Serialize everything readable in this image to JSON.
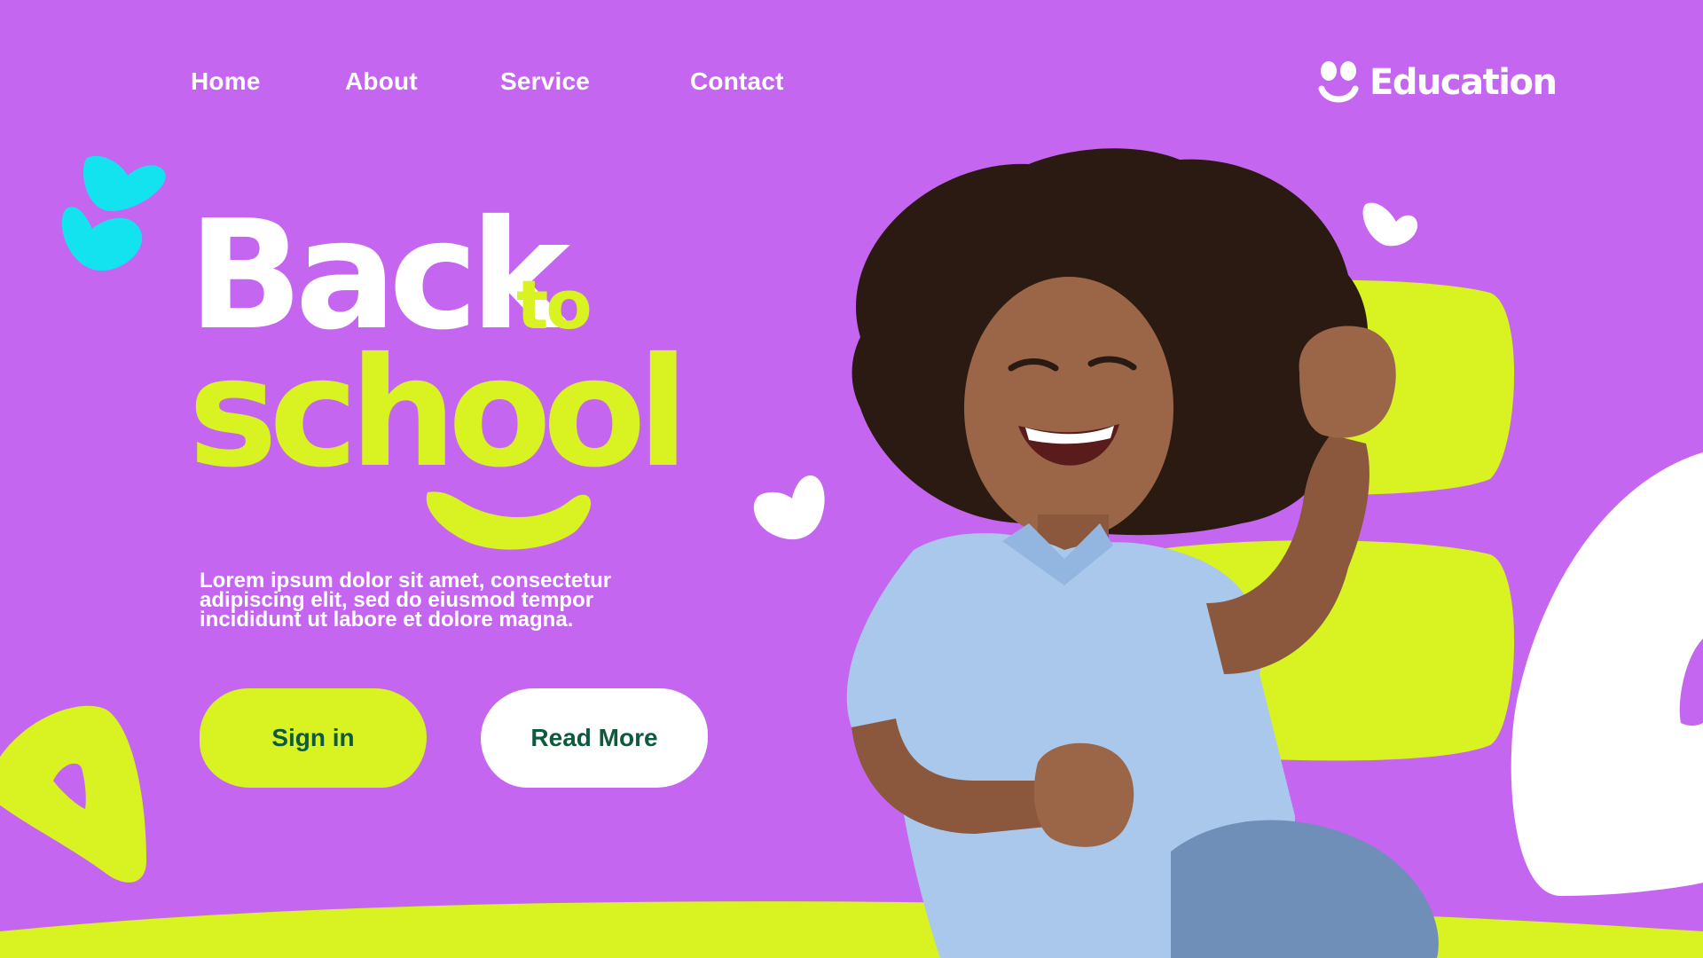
{
  "nav": {
    "links": [
      {
        "label": "Home"
      },
      {
        "label": "About"
      },
      {
        "label": "Service"
      },
      {
        "label": "Contact"
      }
    ]
  },
  "brand": {
    "name": "Education",
    "icon": "smiley-face-icon"
  },
  "hero": {
    "line1": "Back",
    "line1b": "to",
    "line2": "school",
    "description": "Lorem ipsum dolor sit amet, consectetur adipiscing elit, sed do eiusmod tempor incididunt ut labore et dolore magna."
  },
  "buttons": {
    "signin": "Sign in",
    "read_more": "Read More"
  },
  "colors": {
    "background": "#c566f0",
    "lime": "#d8f222",
    "cyan": "#12e3ef",
    "white": "#ffffff",
    "button_text": "#0e5a3c"
  }
}
